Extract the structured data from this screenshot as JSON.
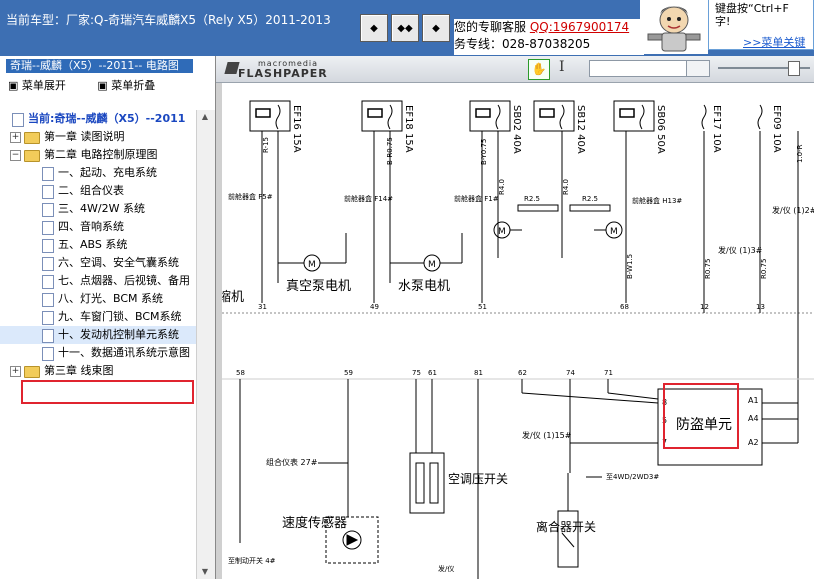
{
  "header": {
    "vehicle": "当前车型：厂家:Q-奇瑞汽车威麟X5（Rely X5）2011-2013",
    "nav_buttons": [
      "◆",
      "◆◆",
      "◆"
    ],
    "support_label": "您的专聊客服",
    "qq": "QQ:1967900174",
    "hotline": "务专线：028-87038205",
    "tip_line1": "键盘按“Ctrl+F",
    "tip_line2": "字!",
    "tip_link": ">>菜单关键"
  },
  "sidebar": {
    "title": "奇瑞--威麟（X5）--2011-- 电路图",
    "expand_label": "菜单展开",
    "collapse_label": "菜单折叠",
    "root": "当前:奇瑞--威麟（X5）--2011",
    "items": [
      {
        "label": "第一章 读图说明",
        "level": 0,
        "type": "folder",
        "expander": "+"
      },
      {
        "label": "第二章 电路控制原理图",
        "level": 0,
        "type": "folder",
        "expander": "−"
      },
      {
        "label": "一、起动、充电系统",
        "level": 1,
        "type": "doc"
      },
      {
        "label": "二、组合仪表",
        "level": 1,
        "type": "doc"
      },
      {
        "label": "三、4W/2W 系统",
        "level": 1,
        "type": "doc"
      },
      {
        "label": "四、音响系统",
        "level": 1,
        "type": "doc"
      },
      {
        "label": "五、ABS 系统",
        "level": 1,
        "type": "doc"
      },
      {
        "label": "六、空调、安全气囊系统",
        "level": 1,
        "type": "doc"
      },
      {
        "label": "七、点烟器、后视镜、备用",
        "level": 1,
        "type": "doc"
      },
      {
        "label": "八、灯光、BCM 系统",
        "level": 1,
        "type": "doc"
      },
      {
        "label": "九、车窗门锁、BCM系统",
        "level": 1,
        "type": "doc"
      },
      {
        "label": "十、发动机控制单元系统",
        "level": 1,
        "type": "doc",
        "selected": true
      },
      {
        "label": "十一、数据通讯系统示意图",
        "level": 1,
        "type": "doc"
      },
      {
        "label": "第三章 线束图",
        "level": 0,
        "type": "folder",
        "expander": "+"
      }
    ]
  },
  "viewer": {
    "logo_small": "macromedia",
    "logo": "FLASHPAPER",
    "search_value": ""
  },
  "diagram": {
    "fuses": [
      "EF16 15A",
      "EF18 15A",
      "SB02 40A",
      "SB12 40A",
      "SB06 50A",
      "EF17 10A",
      "EF09 10A"
    ],
    "wires_top": [
      "R-15",
      "B-Y0.75",
      "B-R0.75",
      "R4.0",
      "R4.0",
      "R2.5",
      "R2.5",
      "B-W1.5",
      "R0.75",
      "R0.75",
      "1.0-R"
    ],
    "labels": {
      "vacuum_pump": "真空泵电机",
      "water_pump": "水泵电机",
      "compressor": "缩机",
      "front_box_f5": "前舱器盒 F5#",
      "front_box_f14": "前舱器盒 F14#",
      "front_box_f1": "前舱器盒 F1#",
      "front_box_h13": "前舱器盒 H13#",
      "fa_yi_3": "发/仪 (1)3#",
      "fa_yi_2": "发/仪 (1)2#",
      "fa_yi_15": "发/仪 (1)15#",
      "combo_meter": "组合仪表 27#",
      "speed_sensor": "速度传感器",
      "ac_switch": "空调压开关",
      "clutch_switch": "离合器开关",
      "immobilizer": "防盗单元",
      "to_4wd": "至4WD/2WD3#",
      "to_brake": "至制动开关 4#",
      "fa_yi_bottom": "发/仪"
    },
    "pins_mid": [
      "31",
      "49",
      "51",
      "68",
      "12",
      "13"
    ],
    "pins_low": [
      "58",
      "59",
      "75",
      "61",
      "81",
      "62",
      "74",
      "71"
    ],
    "immo_pins": [
      "8",
      "5",
      "7"
    ],
    "immo_outputs": [
      "A1",
      "A4",
      "A2"
    ]
  }
}
